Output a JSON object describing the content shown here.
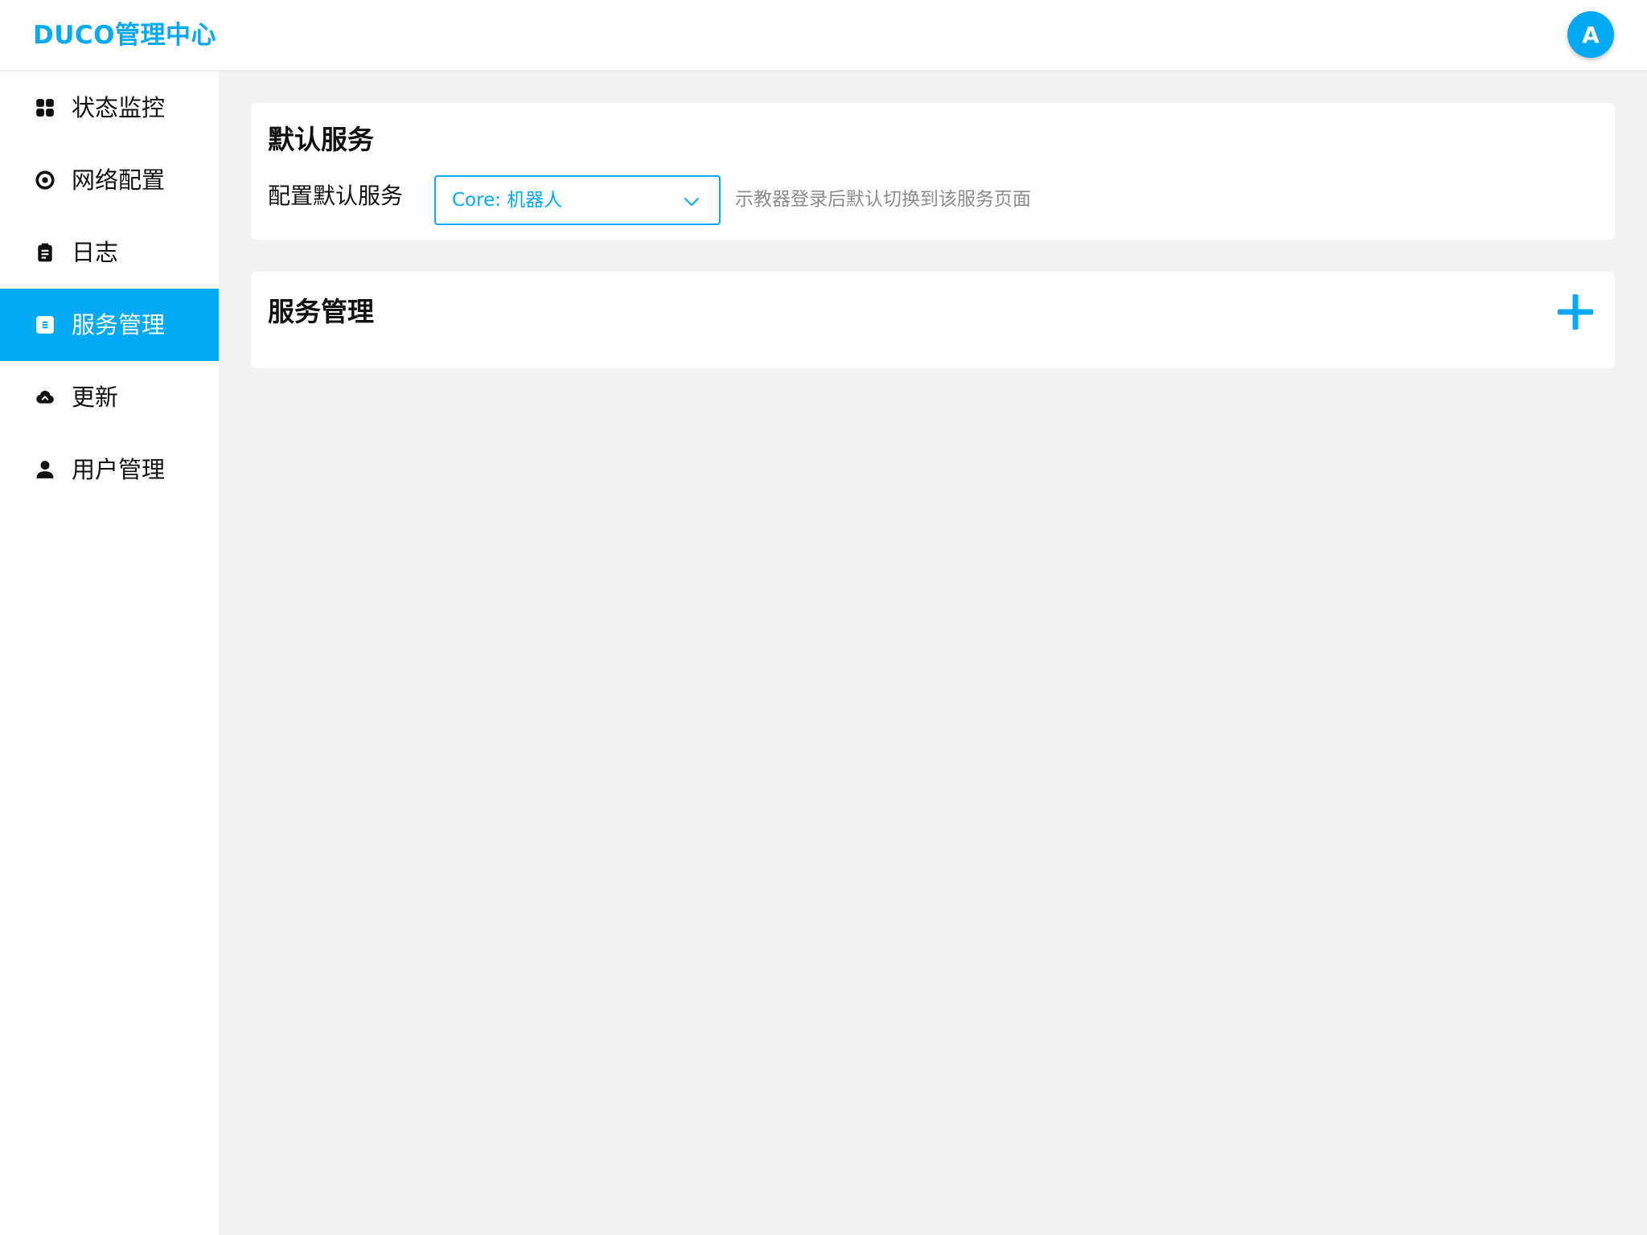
{
  "header": {
    "brand": "DUCO管理中心",
    "avatar_letter": "A"
  },
  "sidebar": {
    "items": [
      {
        "label": "状态监控",
        "icon": "dashboard-icon",
        "active": false
      },
      {
        "label": "网络配置",
        "icon": "network-icon",
        "active": false
      },
      {
        "label": "日志",
        "icon": "clipboard-icon",
        "active": false
      },
      {
        "label": "服务管理",
        "icon": "service-icon",
        "active": true
      },
      {
        "label": "更新",
        "icon": "cloud-icon",
        "active": false
      },
      {
        "label": "用户管理",
        "icon": "user-icon",
        "active": false
      }
    ]
  },
  "default_service": {
    "title": "默认服务",
    "field_label": "配置默认服务",
    "selected_value": "Core: 机器人",
    "hint": "示教器登录后默认切换到该服务页面"
  },
  "service_management": {
    "title": "服务管理",
    "add_icon": "plus-icon"
  },
  "colors": {
    "accent": "#03a9f4",
    "background": "#f3f3f3",
    "card": "#ffffff",
    "hint_text": "#8c8c8c"
  }
}
